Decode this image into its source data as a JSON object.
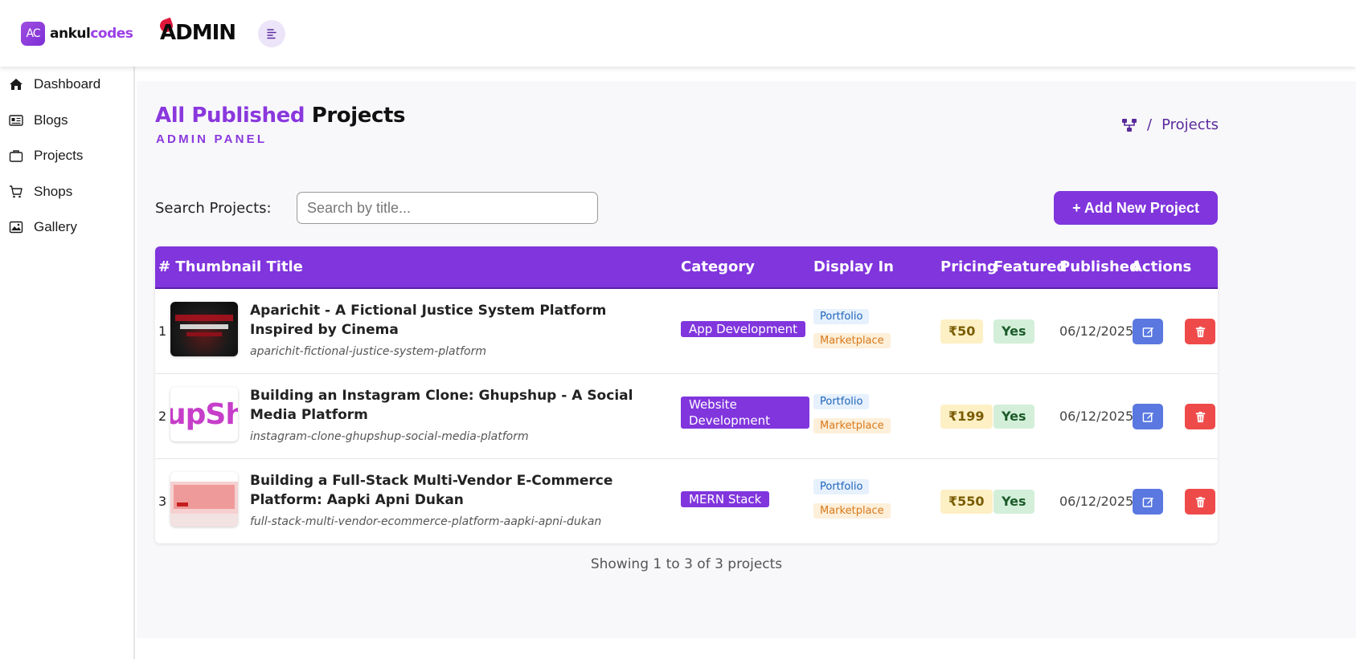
{
  "brand": {
    "badge": "AC",
    "name_part1": "ankul",
    "name_part2": "codes",
    "admin_word": "ADMIN"
  },
  "icons": {
    "menu_toggle": "menu-lines-icon",
    "breadcrumb": "sitemap-icon",
    "edit": "edit-icon",
    "delete": "trash-icon"
  },
  "colors": {
    "accent": "#8035dd",
    "edit_button": "#5a78e0",
    "delete_button": "#ef4a4a"
  },
  "sidebar": {
    "items": [
      {
        "label": "Dashboard",
        "icon": "home-icon"
      },
      {
        "label": "Blogs",
        "icon": "newspaper-icon"
      },
      {
        "label": "Projects",
        "icon": "briefcase-icon"
      },
      {
        "label": "Shops",
        "icon": "cart-icon"
      },
      {
        "label": "Gallery",
        "icon": "image-icon"
      }
    ]
  },
  "page": {
    "title_accent": "All Published",
    "title_rest": "Projects",
    "subtitle": "ADMIN PANEL",
    "breadcrumb_sep": "/",
    "breadcrumb_current": "Projects"
  },
  "search": {
    "label": "Search Projects:",
    "placeholder": "Search by title...",
    "value": ""
  },
  "actions": {
    "add_label": "+ Add New Project"
  },
  "table": {
    "headers": {
      "index_thumb_title": "# Thumbnail Title",
      "category": "Category",
      "display_in": "Display In",
      "pricing": "Pricing",
      "featured": "Featured",
      "published": "Published",
      "actions": "Actions"
    },
    "rows": [
      {
        "index": "1",
        "title": "Aparichit - A Fictional Justice System Platform Inspired by Cinema",
        "slug": "aparichit-fictional-justice-system-platform",
        "category": "App Development",
        "display": [
          "Portfolio",
          "Marketplace"
        ],
        "price": "₹50",
        "featured": "Yes",
        "published": "06/12/2025"
      },
      {
        "index": "2",
        "title": "Building an Instagram Clone: Ghupshup - A Social Media Platform",
        "slug": "instagram-clone-ghupshup-social-media-platform",
        "category": "Website Development",
        "display": [
          "Portfolio",
          "Marketplace"
        ],
        "price": "₹199",
        "featured": "Yes",
        "published": "06/12/2025"
      },
      {
        "index": "3",
        "title": "Building a Full-Stack Multi-Vendor E-Commerce Platform: Aapki Apni Dukan",
        "slug": "full-stack-multi-vendor-ecommerce-platform-aapki-apni-dukan",
        "category": "MERN Stack",
        "display": [
          "Portfolio",
          "Marketplace"
        ],
        "price": "₹550",
        "featured": "Yes",
        "published": "06/12/2025"
      }
    ],
    "footer": "Showing 1 to 3 of 3 projects"
  },
  "thumbnails": {
    "thumb2_text": "upShu"
  }
}
